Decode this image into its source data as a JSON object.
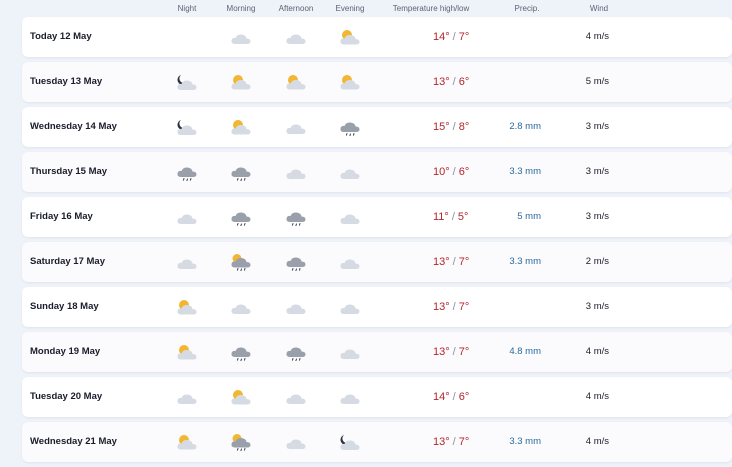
{
  "header": {
    "night": "Night",
    "morning": "Morning",
    "afternoon": "Afternoon",
    "evening": "Evening",
    "temperature": "Temperature high/low",
    "precip": "Precip.",
    "wind": "Wind"
  },
  "rows": [
    {
      "day": "Today 12 May",
      "night": "",
      "morning": "cloud",
      "afternoon": "cloud",
      "evening": "partly-sunny",
      "high": "14°",
      "low": "7°",
      "precip": "",
      "wind": "4 m/s"
    },
    {
      "day": "Tuesday 13 May",
      "night": "moon-cloud",
      "morning": "partly-sunny",
      "afternoon": "partly-sunny",
      "evening": "partly-sunny",
      "high": "13°",
      "low": "6°",
      "precip": "",
      "wind": "5 m/s"
    },
    {
      "day": "Wednesday 14 May",
      "night": "moon-cloud",
      "morning": "partly-sunny",
      "afternoon": "cloud",
      "evening": "rain-cloud",
      "high": "15°",
      "low": "8°",
      "precip": "2.8 mm",
      "wind": "3 m/s"
    },
    {
      "day": "Thursday 15 May",
      "night": "rain-cloud",
      "morning": "rain-cloud",
      "afternoon": "cloud",
      "evening": "cloud",
      "high": "10°",
      "low": "6°",
      "precip": "3.3 mm",
      "wind": "3 m/s"
    },
    {
      "day": "Friday 16 May",
      "night": "cloud",
      "morning": "rain-cloud",
      "afternoon": "rain-cloud",
      "evening": "cloud",
      "high": "11°",
      "low": "5°",
      "precip": "5 mm",
      "wind": "3 m/s"
    },
    {
      "day": "Saturday 17 May",
      "night": "cloud",
      "morning": "sun-rain-cloud",
      "afternoon": "rain-cloud",
      "evening": "cloud",
      "high": "13°",
      "low": "7°",
      "precip": "3.3 mm",
      "wind": "2 m/s"
    },
    {
      "day": "Sunday 18 May",
      "night": "partly-sunny",
      "morning": "cloud",
      "afternoon": "cloud",
      "evening": "cloud",
      "high": "13°",
      "low": "7°",
      "precip": "",
      "wind": "3 m/s"
    },
    {
      "day": "Monday 19 May",
      "night": "partly-sunny",
      "morning": "rain-cloud",
      "afternoon": "rain-cloud",
      "evening": "cloud",
      "high": "13°",
      "low": "7°",
      "precip": "4.8 mm",
      "wind": "4 m/s"
    },
    {
      "day": "Tuesday 20 May",
      "night": "cloud",
      "morning": "partly-sunny",
      "afternoon": "cloud",
      "evening": "cloud",
      "high": "14°",
      "low": "6°",
      "precip": "",
      "wind": "4 m/s"
    },
    {
      "day": "Wednesday 21 May",
      "night": "partly-sunny",
      "morning": "sun-rain-cloud",
      "afternoon": "cloud",
      "evening": "moon-cloud",
      "high": "13°",
      "low": "7°",
      "precip": "3.3 mm",
      "wind": "4 m/s"
    }
  ],
  "colors": {
    "temperature": "#b2262c",
    "precip": "#2a6a9e",
    "cloud": "#d6dbe3",
    "rain_cloud": "#9aa0aa",
    "sun": "#f2b632",
    "moon": "#2b3040"
  }
}
